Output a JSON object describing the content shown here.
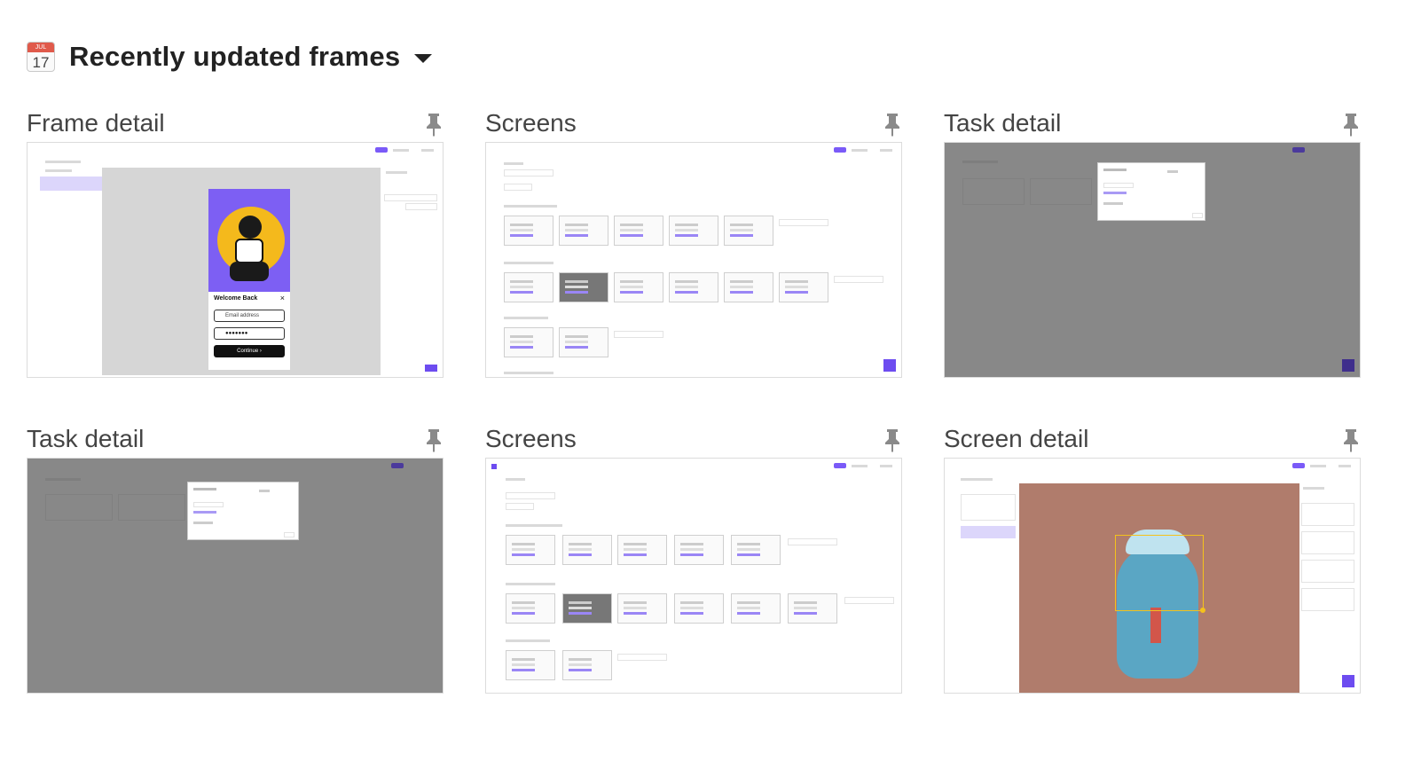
{
  "section": {
    "title": "Recently updated frames",
    "icon": "calendar-icon",
    "calendar_month": "JUL",
    "calendar_day": "17"
  },
  "cards": [
    {
      "title": "Frame detail"
    },
    {
      "title": "Screens"
    },
    {
      "title": "Task detail"
    },
    {
      "title": "Task detail"
    },
    {
      "title": "Screens"
    },
    {
      "title": "Screen detail"
    }
  ],
  "login_preview": {
    "heading": "Welcome Back",
    "close": "×",
    "email_placeholder": "Email address",
    "password_value": "●●●●●●●",
    "continue_label": "Continue ›"
  },
  "colors": {
    "accent": "#6d4cf0",
    "overlay": "#5a5a5a",
    "canvas": "#d6d6d6",
    "art_background": "#b07c6c"
  }
}
